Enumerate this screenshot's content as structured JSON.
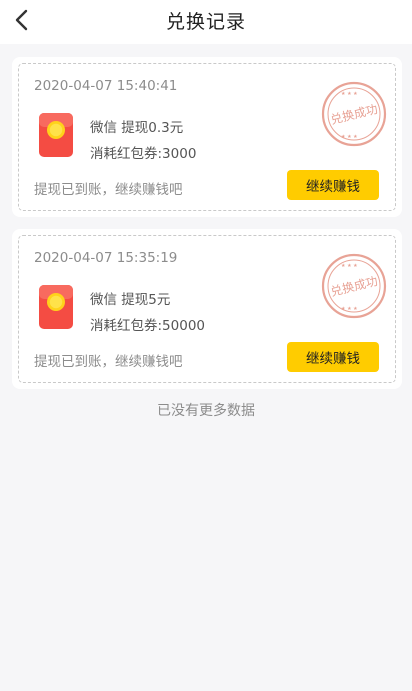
{
  "header": {
    "title": "兑换记录"
  },
  "records": [
    {
      "time": "2020-04-07 15:40:41",
      "title": "微信 提现0.3元",
      "cost": "消耗红包券:3000",
      "note": "提现已到账，继续赚钱吧",
      "button": "继续赚钱",
      "stamp": "兑换成功"
    },
    {
      "time": "2020-04-07 15:35:19",
      "title": "微信 提现5元",
      "cost": "消耗红包券:50000",
      "note": "提现已到账，继续赚钱吧",
      "button": "继续赚钱",
      "stamp": "兑换成功"
    }
  ],
  "footer": {
    "no_more": "已没有更多数据"
  },
  "colors": {
    "accent": "#ffcc00",
    "stamp": "#e8a396",
    "redpack": "#f44c43"
  }
}
